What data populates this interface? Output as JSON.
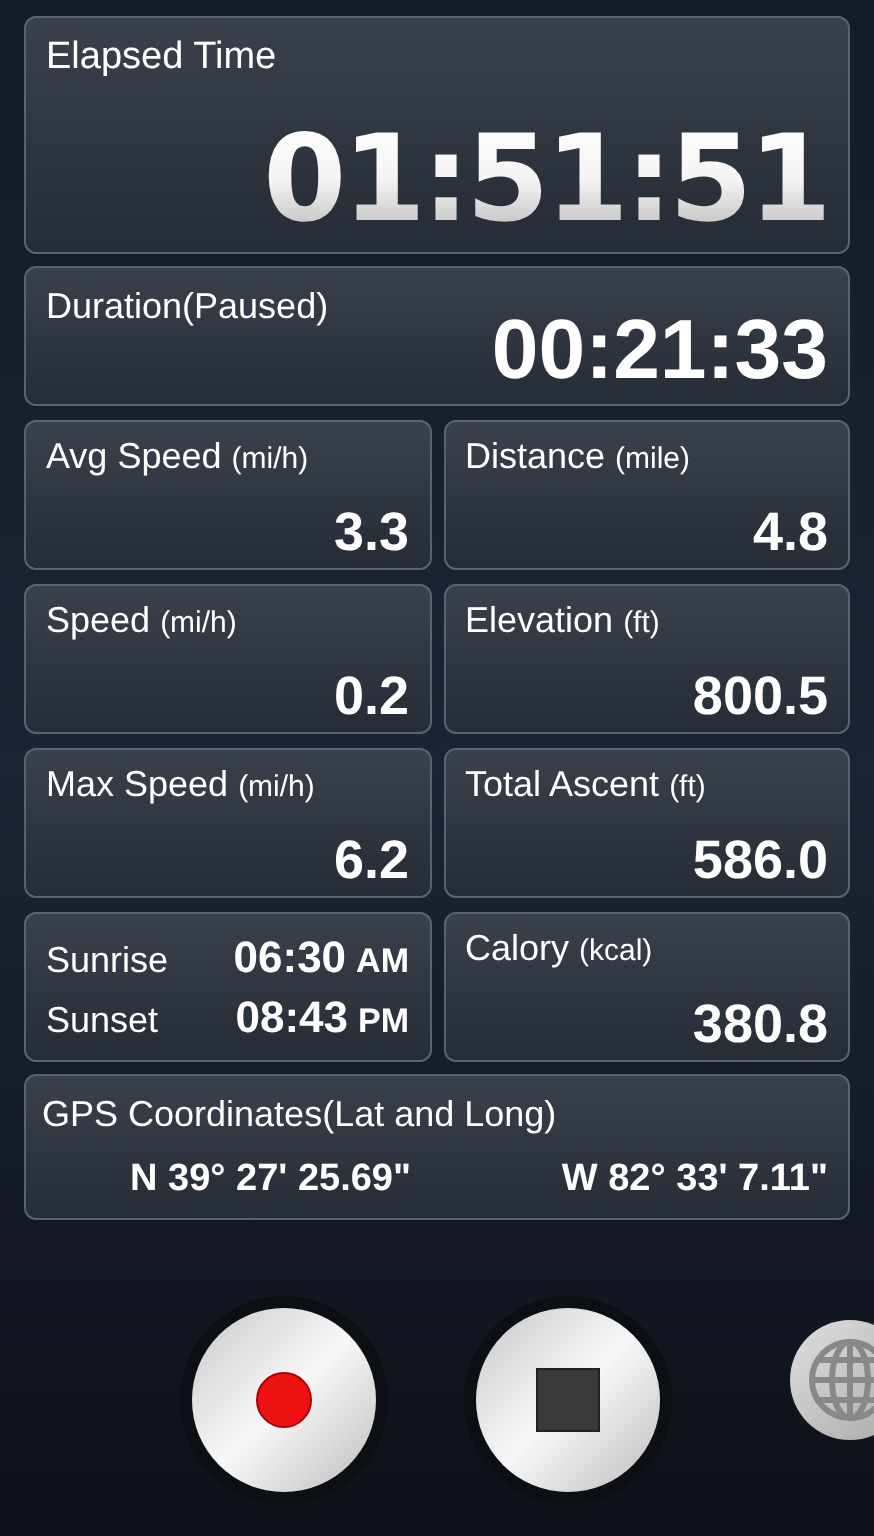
{
  "elapsed": {
    "label": "Elapsed Time",
    "value": "01:51:51"
  },
  "duration": {
    "label": "Duration(Paused)",
    "value": "00:21:33"
  },
  "cells": [
    {
      "kind": "metric",
      "label": "Avg Speed",
      "unit": "(mi/h)",
      "value": "3.3"
    },
    {
      "kind": "metric",
      "label": "Distance",
      "unit": "(mile)",
      "value": "4.8"
    },
    {
      "kind": "metric",
      "label": "Speed",
      "unit": "(mi/h)",
      "value": "0.2"
    },
    {
      "kind": "metric",
      "label": "Elevation",
      "unit": "(ft)",
      "value": "800.5"
    },
    {
      "kind": "metric",
      "label": "Max Speed",
      "unit": "(mi/h)",
      "value": "6.2"
    },
    {
      "kind": "metric",
      "label": "Total Ascent",
      "unit": "(ft)",
      "value": "586.0"
    },
    {
      "kind": "sun",
      "rows": [
        {
          "label": "Sunrise",
          "time": "06:30",
          "suffix": "AM"
        },
        {
          "label": "Sunset",
          "time": "08:43",
          "suffix": "PM"
        }
      ]
    },
    {
      "kind": "metric",
      "label": "Calory",
      "unit": "(kcal)",
      "value": "380.8"
    }
  ],
  "gps": {
    "label": "GPS Coordinates(Lat and Long)",
    "lat": "N 39° 27' 25.69\"",
    "long": "W 82° 33' 7.11\""
  }
}
